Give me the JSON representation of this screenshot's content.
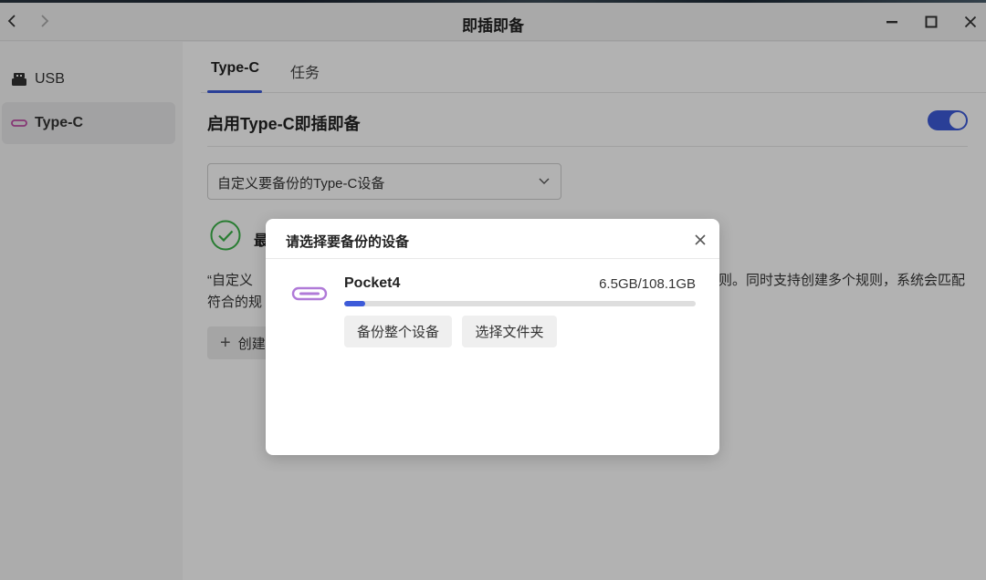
{
  "window": {
    "title": "即插即备"
  },
  "sidebar": {
    "items": [
      {
        "label": "USB",
        "icon": "usb-drive-icon"
      },
      {
        "label": "Type-C",
        "icon": "type-c-icon"
      }
    ],
    "active_index": 1
  },
  "main": {
    "tabs": [
      {
        "label": "Type-C"
      },
      {
        "label": "任务"
      }
    ],
    "active_tab": 0,
    "enable_label": "启用Type-C即插即备",
    "enable_toggle_on": true,
    "select_value": "自定义要备份的Type-C设备",
    "status_text": "最",
    "description": "“自定义",
    "description_right": "则。同时支持创建多个规则，系统会匹配",
    "description_line2": "符合的规",
    "create_button": "创建"
  },
  "dialog": {
    "title": "请选择要备份的设备",
    "device": {
      "name": "Pocket4",
      "size": "6.5GB/108.1GB",
      "used_fraction": 0.06
    },
    "buttons": {
      "backup_all": "备份整个设备",
      "choose_folder": "选择文件夹"
    }
  },
  "colors": {
    "accent": "#3d5bd9",
    "success": "#3cb34a",
    "typec_icon": "#b07ad8"
  }
}
